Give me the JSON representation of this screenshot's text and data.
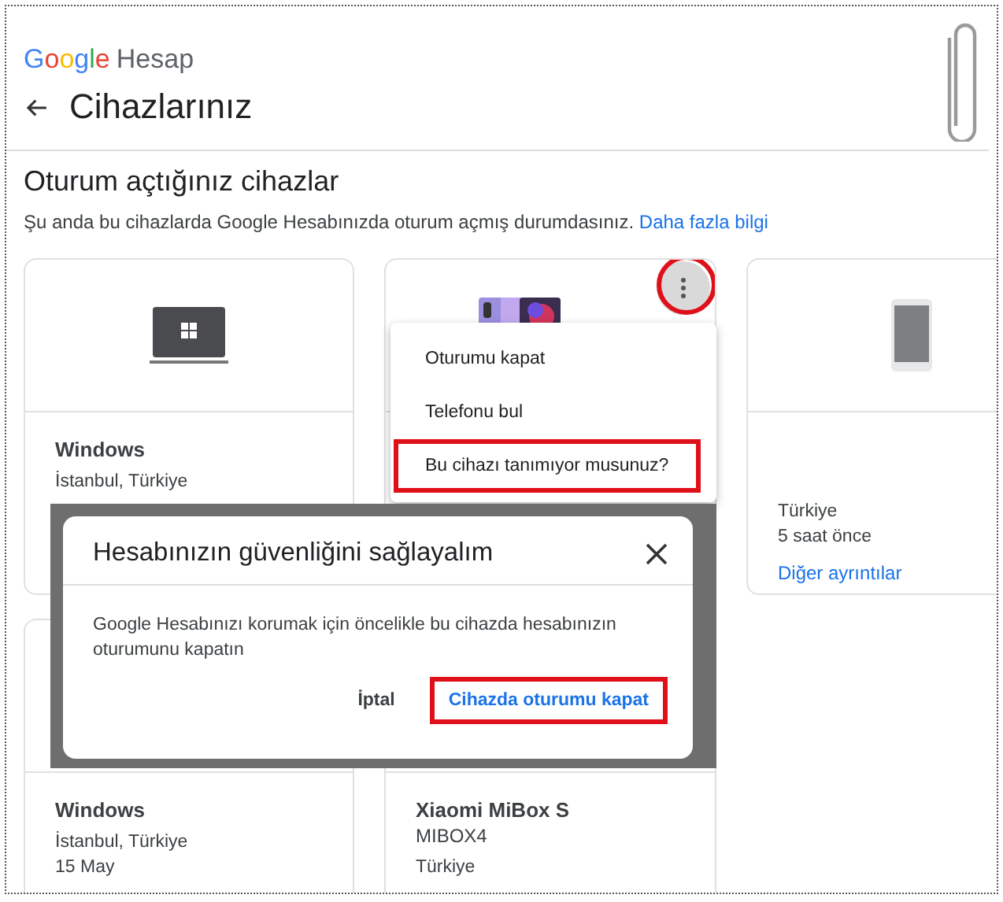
{
  "header": {
    "logo": "Google",
    "product": "Hesap",
    "title": "Cihazlarınız"
  },
  "section": {
    "title": "Oturum açtığınız cihazlar",
    "description": "Şu anda bu cihazlarda Google Hesabınızda oturum açmış durumdasınız.",
    "link": "Daha fazla bilgi"
  },
  "devices": [
    {
      "kind": "laptop",
      "name": "Windows",
      "lines": [
        "İstanbul, Türkiye"
      ]
    },
    {
      "kind": "phones",
      "menu_button": {
        "highlighted": true
      }
    },
    {
      "kind": "phone",
      "lines": [
        "Türkiye",
        "5 saat önce"
      ],
      "link": "Diğer ayrıntılar"
    },
    {
      "kind": "hidden",
      "name": "Windows",
      "lines": [
        "İstanbul, Türkiye",
        "15 May"
      ]
    },
    {
      "kind": "hidden",
      "name": "Xiaomi MiBox S",
      "model": "MIBOX4",
      "lines": [
        "Türkiye"
      ]
    }
  ],
  "menu": {
    "items": [
      {
        "label": "Oturumu kapat",
        "highlighted": false
      },
      {
        "label": "Telefonu bul",
        "highlighted": false
      },
      {
        "label": "Bu cihazı tanımıyor musunuz?",
        "highlighted": true
      }
    ]
  },
  "dialog": {
    "title": "Hesabınızın güvenliğini sağlayalım",
    "body": "Google Hesabınızı korumak için öncelikle bu cihazda hesabınızın oturumunu kapatın",
    "buttons": [
      {
        "label": "İptal",
        "kind": "plain",
        "highlighted": false
      },
      {
        "label": "Cihazda oturumu kapat",
        "kind": "primary",
        "highlighted": true
      }
    ]
  }
}
